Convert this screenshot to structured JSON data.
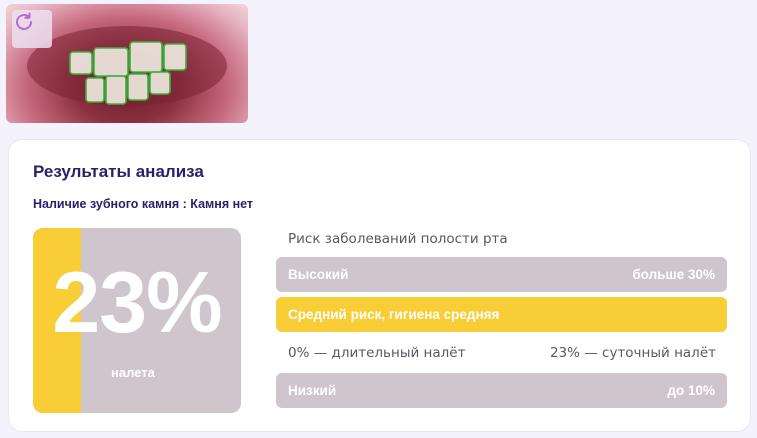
{
  "colors": {
    "accent_yellow": "#f8cd36",
    "neutral_grey": "#cfc6cd",
    "heading_purple": "#2b1f6b",
    "refresh_icon": "#b56ad6"
  },
  "photo": {
    "refresh_icon": "refresh-icon"
  },
  "results": {
    "title": "Результаты анализа",
    "tartar_line": "Наличие зубного камня : Камня нет"
  },
  "plaque": {
    "value_text": "23%",
    "fraction": 0.23,
    "caption": "налета"
  },
  "risk": {
    "heading": "Риск заболеваний полости рта",
    "high": {
      "label": "Высокий",
      "threshold": "больше 30%"
    },
    "current": {
      "label": "Средний риск, гигиена средняя"
    },
    "scale": {
      "left": "0% — длительный налёт",
      "right": "23% — суточный налёт"
    },
    "low": {
      "label": "Низкий",
      "threshold": "до 10%"
    }
  }
}
